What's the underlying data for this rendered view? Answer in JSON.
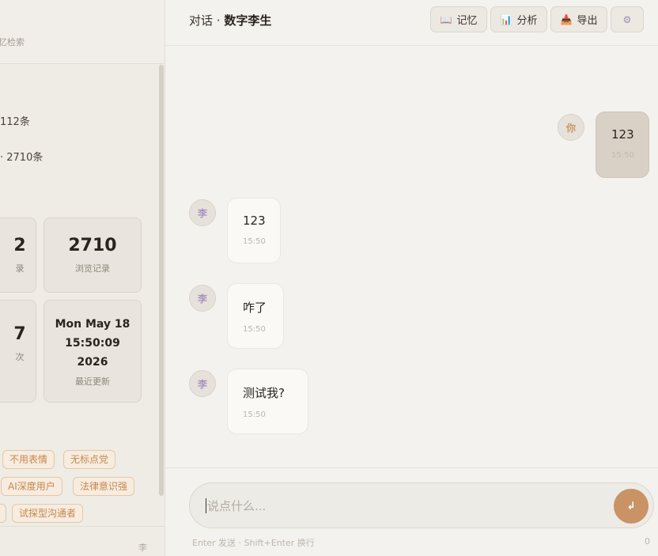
{
  "sidebar": {
    "search_hint_partial": "忆检索",
    "stat_line_1": "112条",
    "stat_line_2": "· 2710条",
    "cards": {
      "partial_1_value": "2",
      "partial_1_label": "录",
      "views_value": "2710",
      "views_label": "浏览记录",
      "partial_2_value": "7",
      "partial_2_label": "次",
      "updated_day": "Mon May 18",
      "updated_time": "15:50:09",
      "updated_year": "2026",
      "updated_label": "最近更新"
    },
    "tags": [
      "不用表情",
      "无标点党",
      "AI深度用户",
      "法律意识强",
      "试探型沟通者"
    ],
    "bottom_char": "李"
  },
  "header": {
    "title_prefix": "对话 · ",
    "title_name": "数字李生",
    "buttons": [
      {
        "icon": "📖",
        "label": "记忆"
      },
      {
        "icon": "📊",
        "label": "分析"
      },
      {
        "icon": "📥",
        "label": "导出"
      },
      {
        "icon": "⚙"
      }
    ]
  },
  "messages": [
    {
      "role": "user",
      "avatar": "你",
      "text": "123",
      "time": "15:50"
    },
    {
      "role": "ai",
      "avatar": "李",
      "text": "123",
      "time": "15:50"
    },
    {
      "role": "ai",
      "avatar": "李",
      "text": "咋了",
      "time": "15:50"
    },
    {
      "role": "ai",
      "avatar": "李",
      "text": "测试我?",
      "time": "15:50"
    }
  ],
  "composer": {
    "placeholder": "说点什么...",
    "send_icon": "↲",
    "hint": "Enter 发送 · Shift+Enter 换行",
    "char_count": "0"
  },
  "colors": {
    "accent": "#c99365",
    "tag_text": "#c8874c",
    "user_bubble": "#d9d0c6",
    "ai_bubble": "#faf9f6"
  }
}
